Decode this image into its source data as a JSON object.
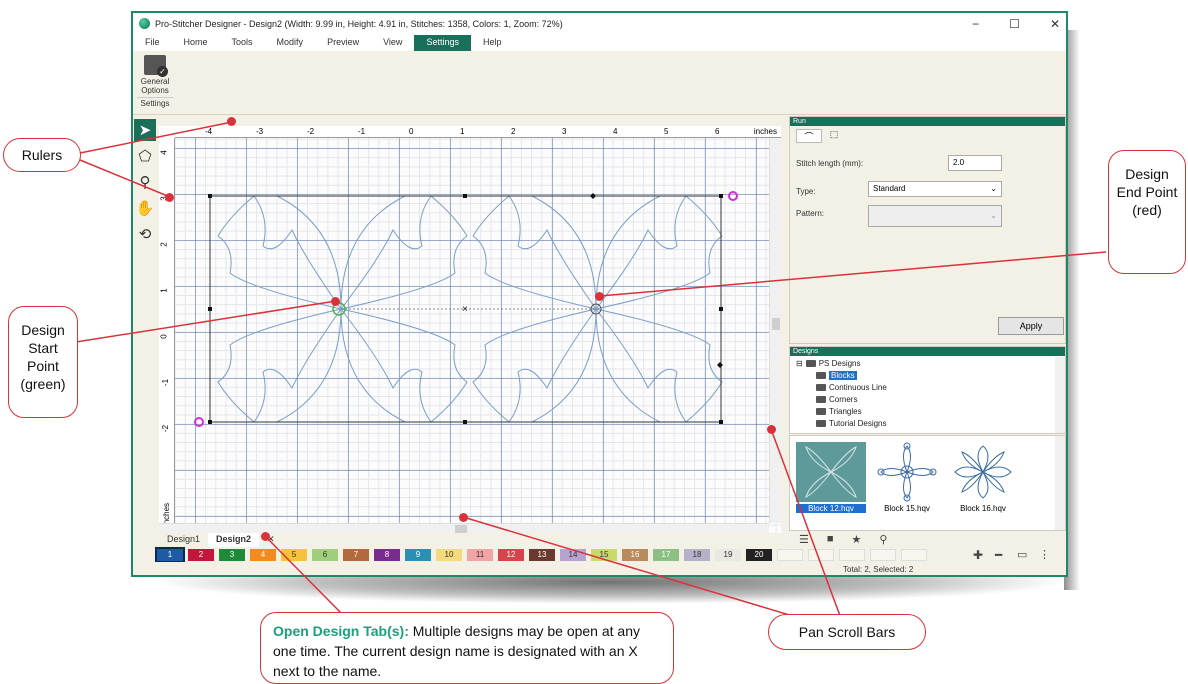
{
  "window": {
    "title": "Pro-Stitcher Designer - Design2 (Width: 9.99 in, Height: 4.91 in, Stitches: 1358, Colors: 1, Zoom: 72%)",
    "controls": [
      "−",
      "☐",
      "✕"
    ]
  },
  "menu": [
    "File",
    "Home",
    "Tools",
    "Modify",
    "Preview",
    "View",
    "Settings",
    "Help"
  ],
  "active_menu": "Settings",
  "ribbon": {
    "button_line1": "General",
    "button_line2": "Options",
    "group_label": "Settings"
  },
  "ruler": {
    "units": "inches",
    "top_ticks": [
      "-4",
      "-3",
      "-2",
      "-1",
      "0",
      "1",
      "2",
      "3",
      "4",
      "5",
      "6"
    ],
    "left_ticks": [
      "4",
      "3",
      "2",
      "1",
      "0",
      "-1",
      "-2"
    ],
    "left_units": "inches"
  },
  "tools": [
    "select-arrow-icon",
    "node-edit-icon",
    "zoom-icon",
    "pan-hand-icon",
    "rotate-icon"
  ],
  "design_tabs": [
    {
      "label": "Design1",
      "current": false
    },
    {
      "label": "Design2",
      "current": true
    }
  ],
  "tab_close": "✕",
  "palette": [
    {
      "n": "1",
      "color": "#1f5aa6"
    },
    {
      "n": "2",
      "color": "#c4153a"
    },
    {
      "n": "3",
      "color": "#1e8a3a"
    },
    {
      "n": "4",
      "color": "#f28a1e"
    },
    {
      "n": "5",
      "color": "#f6c23c"
    },
    {
      "n": "6",
      "color": "#9fcf7b"
    },
    {
      "n": "7",
      "color": "#b06a3c"
    },
    {
      "n": "8",
      "color": "#7a2c8e"
    },
    {
      "n": "9",
      "color": "#2a8fb0"
    },
    {
      "n": "10",
      "color": "#f5d97e"
    },
    {
      "n": "11",
      "color": "#f2a5a6"
    },
    {
      "n": "12",
      "color": "#d9434e"
    },
    {
      "n": "13",
      "color": "#6b3a2e"
    },
    {
      "n": "14",
      "color": "#b7a3d2"
    },
    {
      "n": "15",
      "color": "#c9da6b"
    },
    {
      "n": "16",
      "color": "#b98a5b"
    },
    {
      "n": "17",
      "color": "#8dbf83"
    },
    {
      "n": "18",
      "color": "#b6b0c8"
    },
    {
      "n": "19",
      "color": "#ebe7e2"
    },
    {
      "n": "20",
      "color": "#222222"
    }
  ],
  "status": "Total: 2, Selected: 2",
  "run_panel": {
    "header": "Run",
    "stitch_length_label": "Stitch length (mm):",
    "stitch_length_value": "2.0",
    "type_label": "Type:",
    "type_value": "Standard",
    "pattern_label": "Pattern:",
    "pattern_value": "",
    "apply": "Apply"
  },
  "designs_panel": {
    "header": "Designs",
    "root": "PS Designs",
    "items": [
      "Blocks",
      "Continuous Line",
      "Corners",
      "Triangles",
      "Tutorial Designs"
    ],
    "selected": "Blocks",
    "thumbnails": [
      "Block 12.hqv",
      "Block 15.hqv",
      "Block 16.hqv"
    ]
  },
  "callouts": {
    "rulers": "Rulers",
    "start_point": "Design Start Point (green)",
    "end_point": "Design End Point (red)",
    "pan": "Pan Scroll Bars",
    "tabs_title": "Open Design Tab(s):",
    "tabs_body": "Multiple designs may be open at any one time. The current design name is designated with an X next to the name."
  },
  "colors": {
    "accent": "#17705a",
    "callout_red": "#d9323a",
    "stitch_blue": "#7b9ec6"
  }
}
